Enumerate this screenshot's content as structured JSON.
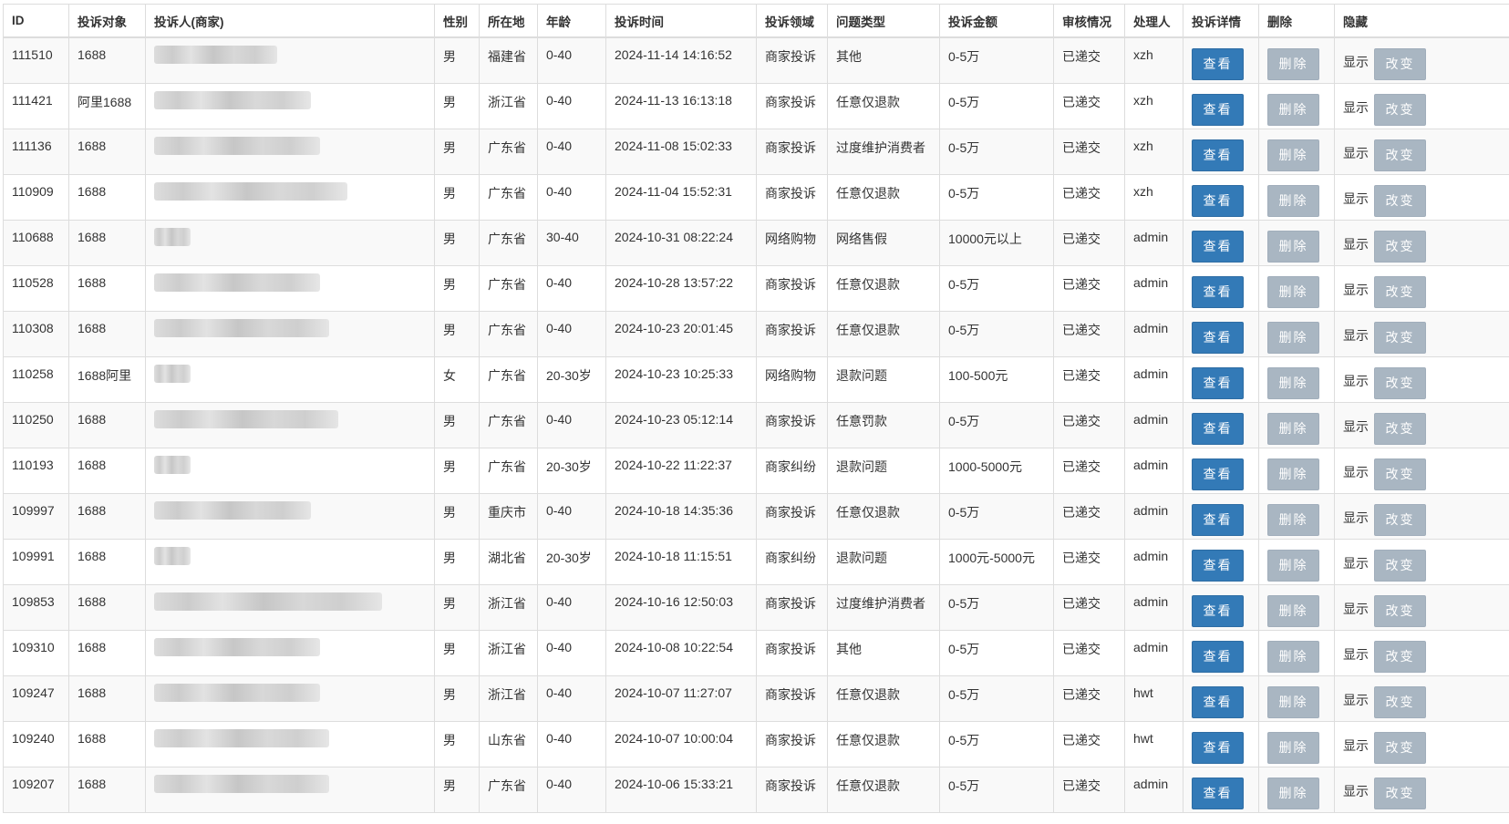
{
  "headers": [
    "ID",
    "投诉对象",
    "投诉人(商家)",
    "性别",
    "所在地",
    "年龄",
    "投诉时间",
    "投诉领域",
    "问题类型",
    "投诉金额",
    "审核情况",
    "处理人",
    "投诉详情",
    "删除",
    "隐藏"
  ],
  "buttons": {
    "view": "查看",
    "delete": "删除",
    "show": "显示",
    "change": "改变"
  },
  "rows": [
    {
      "id": "111510",
      "target": "1688",
      "gender": "男",
      "location": "福建省",
      "age": "0-40",
      "time": "2024-11-14 14:16:52",
      "domain": "商家投诉",
      "issue": "其他",
      "amount": "0-5万",
      "status": "已递交",
      "handler": "xzh"
    },
    {
      "id": "111421",
      "target": "阿里1688",
      "gender": "男",
      "location": "浙江省",
      "age": "0-40",
      "time": "2024-11-13 16:13:18",
      "domain": "商家投诉",
      "issue": "任意仅退款",
      "amount": "0-5万",
      "status": "已递交",
      "handler": "xzh"
    },
    {
      "id": "111136",
      "target": "1688",
      "gender": "男",
      "location": "广东省",
      "age": "0-40",
      "time": "2024-11-08 15:02:33",
      "domain": "商家投诉",
      "issue": "过度维护消费者",
      "amount": "0-5万",
      "status": "已递交",
      "handler": "xzh"
    },
    {
      "id": "110909",
      "target": "1688",
      "gender": "男",
      "location": "广东省",
      "age": "0-40",
      "time": "2024-11-04 15:52:31",
      "domain": "商家投诉",
      "issue": "任意仅退款",
      "amount": "0-5万",
      "status": "已递交",
      "handler": "xzh"
    },
    {
      "id": "110688",
      "target": "1688",
      "gender": "男",
      "location": "广东省",
      "age": "30-40",
      "time": "2024-10-31 08:22:24",
      "domain": "网络购物",
      "issue": "网络售假",
      "amount": "10000元以上",
      "status": "已递交",
      "handler": "admin"
    },
    {
      "id": "110528",
      "target": "1688",
      "gender": "男",
      "location": "广东省",
      "age": "0-40",
      "time": "2024-10-28 13:57:22",
      "domain": "商家投诉",
      "issue": "任意仅退款",
      "amount": "0-5万",
      "status": "已递交",
      "handler": "admin"
    },
    {
      "id": "110308",
      "target": "1688",
      "gender": "男",
      "location": "广东省",
      "age": "0-40",
      "time": "2024-10-23 20:01:45",
      "domain": "商家投诉",
      "issue": "任意仅退款",
      "amount": "0-5万",
      "status": "已递交",
      "handler": "admin"
    },
    {
      "id": "110258",
      "target": "1688阿里",
      "gender": "女",
      "location": "广东省",
      "age": "20-30岁",
      "time": "2024-10-23 10:25:33",
      "domain": "网络购物",
      "issue": "退款问题",
      "amount": "100-500元",
      "status": "已递交",
      "handler": "admin"
    },
    {
      "id": "110250",
      "target": "1688",
      "gender": "男",
      "location": "广东省",
      "age": "0-40",
      "time": "2024-10-23 05:12:14",
      "domain": "商家投诉",
      "issue": "任意罚款",
      "amount": "0-5万",
      "status": "已递交",
      "handler": "admin"
    },
    {
      "id": "110193",
      "target": "1688",
      "gender": "男",
      "location": "广东省",
      "age": "20-30岁",
      "time": "2024-10-22 11:22:37",
      "domain": "商家纠纷",
      "issue": "退款问题",
      "amount": "1000-5000元",
      "status": "已递交",
      "handler": "admin"
    },
    {
      "id": "109997",
      "target": "1688",
      "gender": "男",
      "location": "重庆市",
      "age": "0-40",
      "time": "2024-10-18 14:35:36",
      "domain": "商家投诉",
      "issue": "任意仅退款",
      "amount": "0-5万",
      "status": "已递交",
      "handler": "admin"
    },
    {
      "id": "109991",
      "target": "1688",
      "gender": "男",
      "location": "湖北省",
      "age": "20-30岁",
      "time": "2024-10-18 11:15:51",
      "domain": "商家纠纷",
      "issue": "退款问题",
      "amount": "1000元-5000元",
      "status": "已递交",
      "handler": "admin"
    },
    {
      "id": "109853",
      "target": "1688",
      "gender": "男",
      "location": "浙江省",
      "age": "0-40",
      "time": "2024-10-16 12:50:03",
      "domain": "商家投诉",
      "issue": "过度维护消费者",
      "amount": "0-5万",
      "status": "已递交",
      "handler": "admin"
    },
    {
      "id": "109310",
      "target": "1688",
      "gender": "男",
      "location": "浙江省",
      "age": "0-40",
      "time": "2024-10-08 10:22:54",
      "domain": "商家投诉",
      "issue": "其他",
      "amount": "0-5万",
      "status": "已递交",
      "handler": "admin"
    },
    {
      "id": "109247",
      "target": "1688",
      "gender": "男",
      "location": "浙江省",
      "age": "0-40",
      "time": "2024-10-07 11:27:07",
      "domain": "商家投诉",
      "issue": "任意仅退款",
      "amount": "0-5万",
      "status": "已递交",
      "handler": "hwt"
    },
    {
      "id": "109240",
      "target": "1688",
      "gender": "男",
      "location": "山东省",
      "age": "0-40",
      "time": "2024-10-07 10:00:04",
      "domain": "商家投诉",
      "issue": "任意仅退款",
      "amount": "0-5万",
      "status": "已递交",
      "handler": "hwt"
    },
    {
      "id": "109207",
      "target": "1688",
      "gender": "男",
      "location": "广东省",
      "age": "0-40",
      "time": "2024-10-06 15:33:21",
      "domain": "商家投诉",
      "issue": "任意仅退款",
      "amount": "0-5万",
      "status": "已递交",
      "handler": "admin"
    }
  ]
}
